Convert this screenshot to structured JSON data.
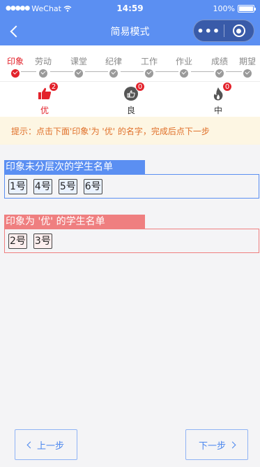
{
  "status_bar": {
    "carrier": "WeChat",
    "time": "14:59",
    "battery": "100%"
  },
  "nav": {
    "title": "简易模式"
  },
  "steps": [
    {
      "label": "印象",
      "active": true
    },
    {
      "label": "劳动",
      "active": false
    },
    {
      "label": "课堂",
      "active": false
    },
    {
      "label": "纪律",
      "active": false
    },
    {
      "label": "工作",
      "active": false
    },
    {
      "label": "作业",
      "active": false
    },
    {
      "label": "成绩",
      "active": false
    },
    {
      "label": "期望",
      "active": false
    }
  ],
  "ratings": [
    {
      "label": "优",
      "count": "2",
      "icon": "thumbs-up-icon"
    },
    {
      "label": "良",
      "count": "0",
      "icon": "thumb-circle-icon"
    },
    {
      "label": "中",
      "count": "0",
      "icon": "flame-icon"
    }
  ],
  "tip": "提示：点击下面'印象'为 '优' 的名字，完成后点下一步",
  "groups": {
    "unassigned": {
      "title": "印象未分层次的学生名单",
      "color": "#5b8ff2",
      "students": [
        "1号",
        "4号",
        "5号",
        "6号"
      ]
    },
    "excellent": {
      "title": "印象为 '优' 的学生名单",
      "color": "#ef7f80",
      "students": [
        "2号",
        "3号"
      ]
    }
  },
  "buttons": {
    "prev": "上一步",
    "next": "下一步"
  }
}
